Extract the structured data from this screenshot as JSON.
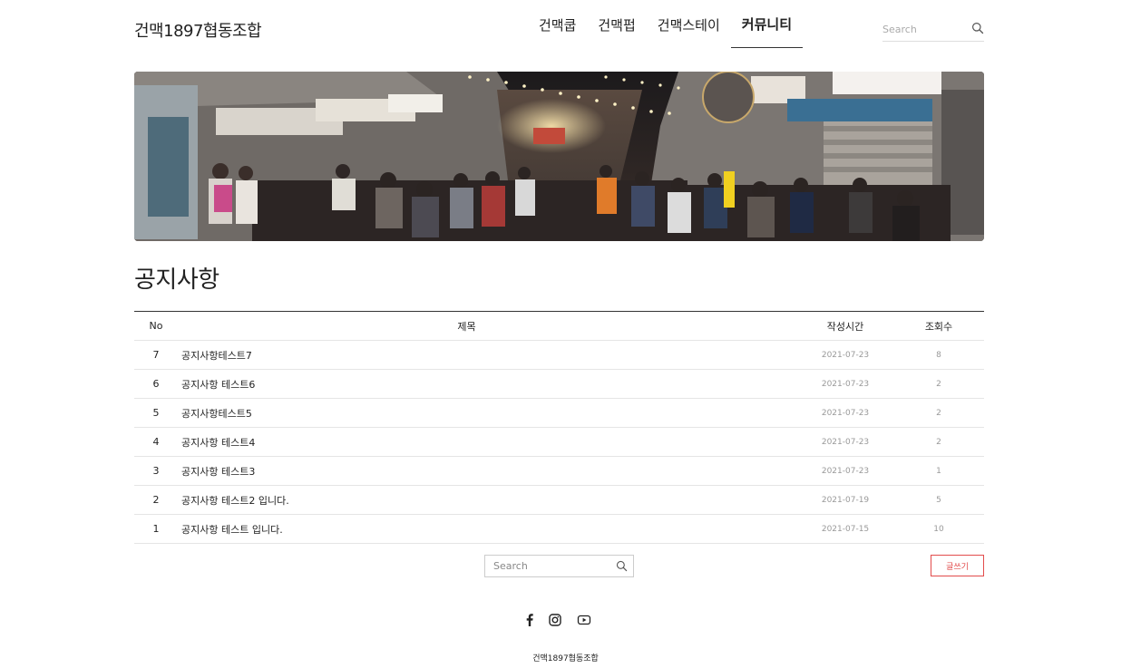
{
  "header": {
    "logo": "건맥1897협동조합",
    "nav": [
      {
        "label": "건맥쿱"
      },
      {
        "label": "건맥펍"
      },
      {
        "label": "건맥스테이"
      },
      {
        "label": "커뮤니티"
      }
    ],
    "search_placeholder": "Search"
  },
  "page": {
    "title": "공지사항"
  },
  "board": {
    "headers": {
      "no": "No",
      "title": "제목",
      "date": "작성시간",
      "views": "조회수"
    },
    "rows": [
      {
        "no": "7",
        "title": "공지사항테스트7",
        "date": "2021-07-23",
        "views": "8"
      },
      {
        "no": "6",
        "title": "공지사항 테스트6",
        "date": "2021-07-23",
        "views": "2"
      },
      {
        "no": "5",
        "title": "공지사항테스트5",
        "date": "2021-07-23",
        "views": "2"
      },
      {
        "no": "4",
        "title": "공지사항 테스트4",
        "date": "2021-07-23",
        "views": "2"
      },
      {
        "no": "3",
        "title": "공지사항 테스트3",
        "date": "2021-07-23",
        "views": "1"
      },
      {
        "no": "2",
        "title": "공지사항 테스트2 입니다.",
        "date": "2021-07-19",
        "views": "5"
      },
      {
        "no": "1",
        "title": "공지사항 테스트 입니다.",
        "date": "2021-07-15",
        "views": "10"
      }
    ]
  },
  "board_search_placeholder": "Search",
  "write_button": "글쓰기",
  "footer": {
    "name": "건맥1897협동조합",
    "social": [
      "facebook-icon",
      "instagram-icon",
      "youtube-icon"
    ]
  },
  "colors": {
    "accent": "#e24c4c",
    "text": "#222222",
    "muted": "#999999"
  }
}
